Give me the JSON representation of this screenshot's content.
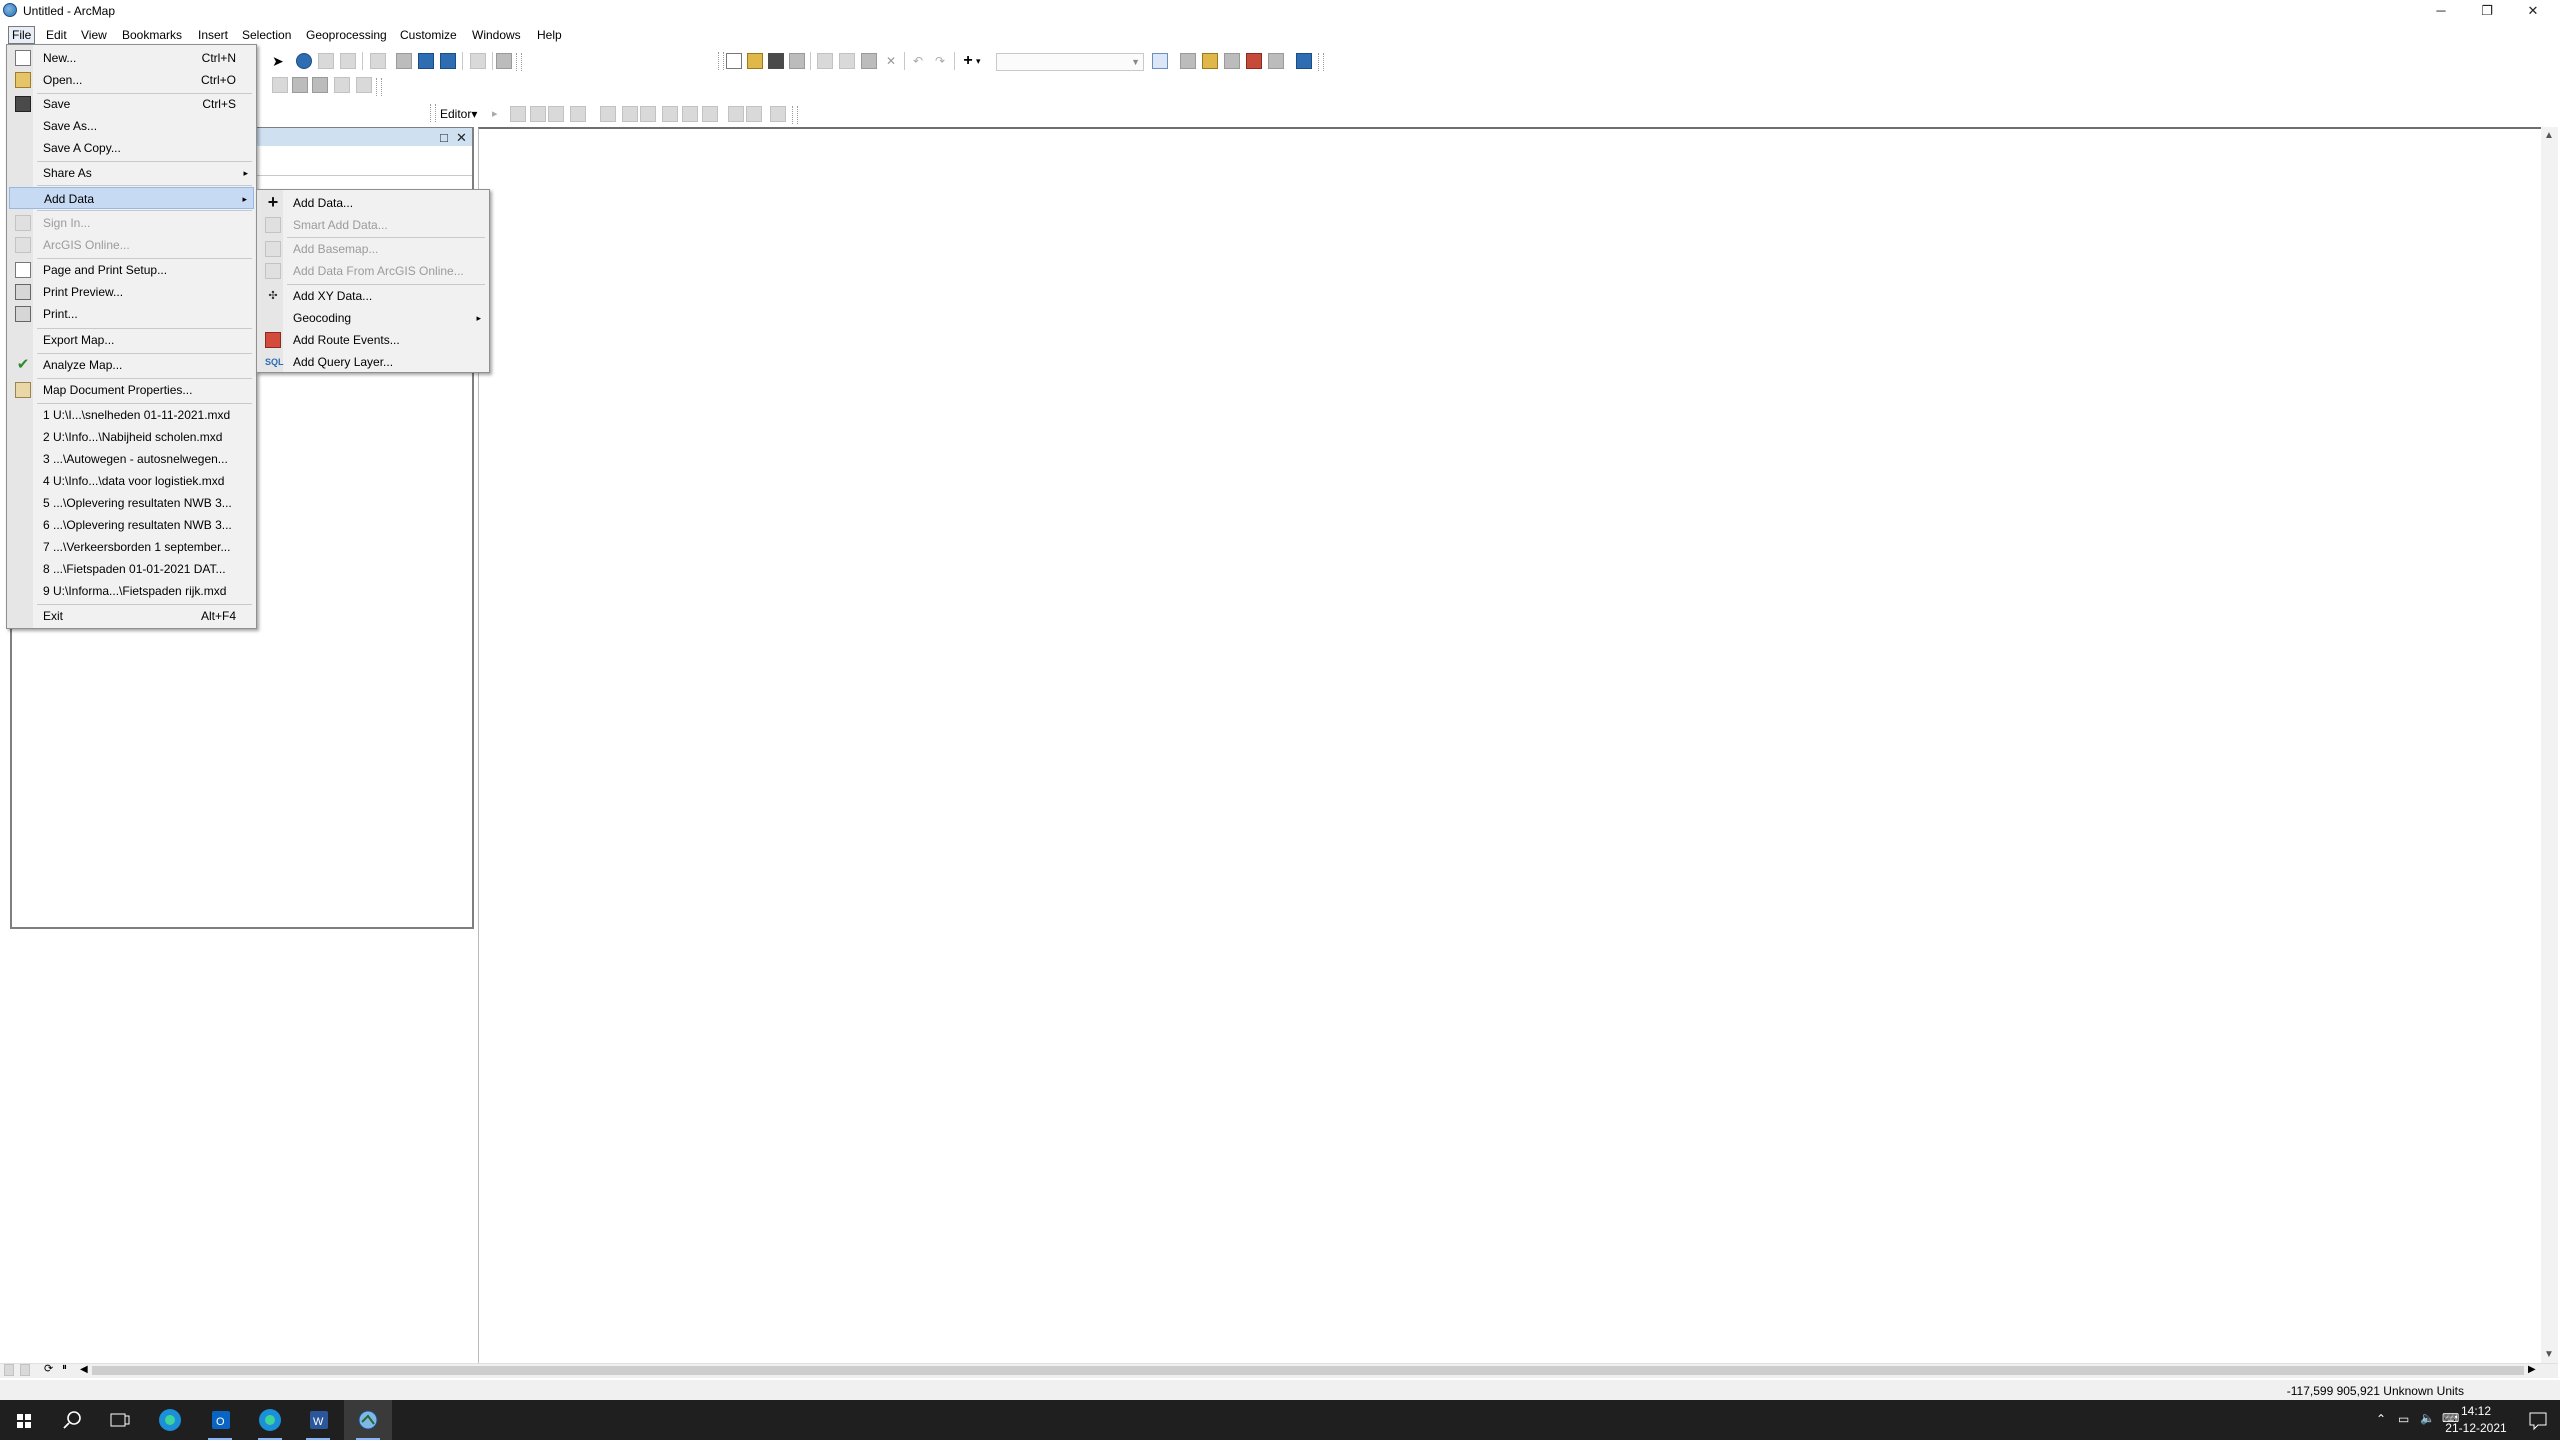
{
  "window": {
    "title": "Untitled - ArcMap",
    "controls": {
      "minimize": "─",
      "maximize": "❐",
      "close": "✕"
    }
  },
  "menubar": [
    "File",
    "Edit",
    "View",
    "Bookmarks",
    "Insert",
    "Selection",
    "Geoprocessing",
    "Customize",
    "Windows",
    "Help"
  ],
  "toolbar": {
    "editor_label": "Editor",
    "editor_arrow": "▾",
    "scale_value": ""
  },
  "file_menu": {
    "items": [
      {
        "label": "New...",
        "shortcut": "Ctrl+N",
        "icon": "new-document-icon"
      },
      {
        "label": "Open...",
        "shortcut": "Ctrl+O",
        "icon": "open-folder-icon"
      },
      {
        "label": "Save",
        "shortcut": "Ctrl+S",
        "icon": "save-icon"
      },
      {
        "label": "Save As...",
        "shortcut": ""
      },
      {
        "label": "Save A Copy...",
        "shortcut": ""
      },
      {
        "label": "Share As",
        "submenu": true
      },
      {
        "label": "Add Data",
        "submenu": true,
        "highlighted": true
      },
      {
        "label": "Sign In...",
        "disabled": true,
        "icon": "sign-in-icon"
      },
      {
        "label": "ArcGIS Online...",
        "disabled": true,
        "icon": "arcgis-online-icon"
      },
      {
        "label": "Page and Print Setup...",
        "icon": "page-setup-icon"
      },
      {
        "label": "Print Preview...",
        "icon": "print-preview-icon"
      },
      {
        "label": "Print...",
        "icon": "print-icon"
      },
      {
        "label": "Export Map..."
      },
      {
        "label": "Analyze Map...",
        "icon": "analyze-check-icon"
      },
      {
        "label": "Map Document Properties...",
        "icon": "properties-icon"
      },
      {
        "label": "1 U:\\I...\\snelheden 01-11-2021.mxd"
      },
      {
        "label": "2 U:\\Info...\\Nabijheid scholen.mxd"
      },
      {
        "label": "3 ...\\Autowegen - autosnelwegen..."
      },
      {
        "label": "4 U:\\Info...\\data voor logistiek.mxd"
      },
      {
        "label": "5 ...\\Oplevering resultaten NWB 3..."
      },
      {
        "label": "6 ...\\Oplevering resultaten NWB 3..."
      },
      {
        "label": "7 ...\\Verkeersborden 1 september..."
      },
      {
        "label": "8 ...\\Fietspaden 01-01-2021 DAT..."
      },
      {
        "label": "9 U:\\Informa...\\Fietspaden rijk.mxd"
      },
      {
        "label": "Exit",
        "shortcut": "Alt+F4"
      }
    ]
  },
  "add_data_menu": {
    "items": [
      {
        "label": "Add Data...",
        "icon": "add-data-plus-icon"
      },
      {
        "label": "Smart Add Data...",
        "disabled": true,
        "icon": "smart-add-icon"
      },
      {
        "label": "Add Basemap...",
        "disabled": true,
        "icon": "basemap-icon"
      },
      {
        "label": "Add Data From ArcGIS Online...",
        "disabled": true,
        "icon": "arcgis-online-icon"
      },
      {
        "label": "Add XY Data...",
        "icon": "xy-data-icon"
      },
      {
        "label": "Geocoding",
        "submenu": true
      },
      {
        "label": "Add Route Events...",
        "icon": "route-events-icon"
      },
      {
        "label": "Add Query Layer...",
        "icon": "query-layer-sql-icon"
      }
    ]
  },
  "toc": {
    "float_icon": "□",
    "close_icon": "✕"
  },
  "status": {
    "coordinates": "-117,599  905,921 Unknown Units"
  },
  "taskbar": {
    "time": "14:12",
    "date": "21-12-2021",
    "apps": [
      "start",
      "search",
      "task-view",
      "edge",
      "outlook",
      "edge-2",
      "word",
      "arcmap"
    ]
  },
  "glyphs": {
    "submenu_arrow": "▸",
    "scroll_up": "▲",
    "scroll_down": "▼",
    "scroll_left": "◀",
    "scroll_right": "▶"
  }
}
